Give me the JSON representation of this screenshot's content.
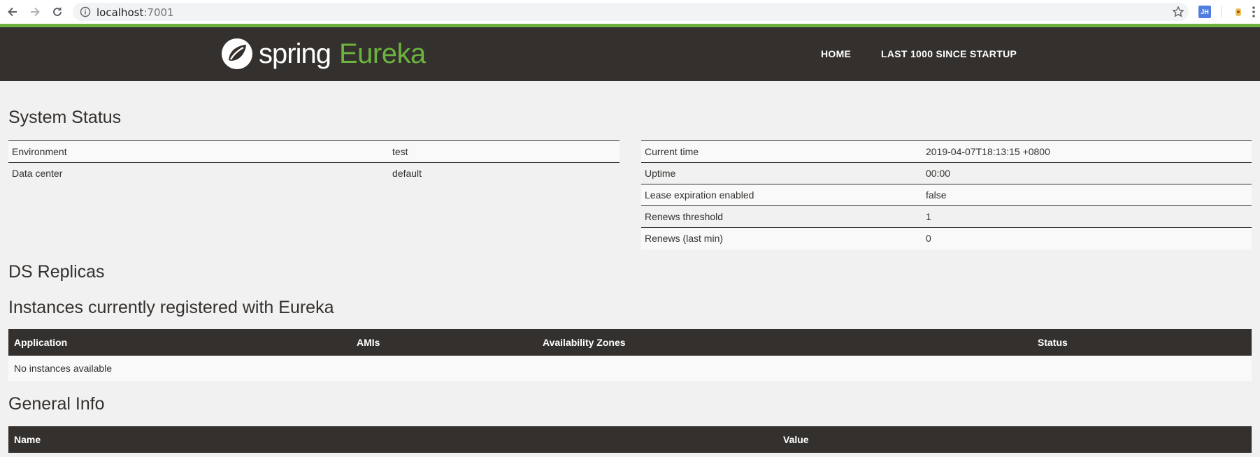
{
  "browser": {
    "url_host": "localhost",
    "url_port": ":7001",
    "ext_badge": "JH"
  },
  "header": {
    "brand_spring": "spring",
    "brand_eureka": "Eureka",
    "nav": [
      "HOME",
      "LAST 1000 SINCE STARTUP"
    ]
  },
  "system_status": {
    "title": "System Status",
    "left": [
      {
        "label": "Environment",
        "value": "test"
      },
      {
        "label": "Data center",
        "value": "default"
      }
    ],
    "right": [
      {
        "label": "Current time",
        "value": "2019-04-07T18:13:15 +0800"
      },
      {
        "label": "Uptime",
        "value": "00:00"
      },
      {
        "label": "Lease expiration enabled",
        "value": "false"
      },
      {
        "label": "Renews threshold",
        "value": "1"
      },
      {
        "label": "Renews (last min)",
        "value": "0"
      }
    ]
  },
  "ds_replicas": {
    "title": "DS Replicas"
  },
  "instances": {
    "title": "Instances currently registered with Eureka",
    "columns": [
      "Application",
      "AMIs",
      "Availability Zones",
      "Status"
    ],
    "empty_message": "No instances available"
  },
  "general_info": {
    "title": "General Info",
    "columns": [
      "Name",
      "Value"
    ]
  },
  "colors": {
    "brand_green": "#6db33f",
    "header_dark": "#34302d",
    "page_bg": "#f1f1f1"
  }
}
